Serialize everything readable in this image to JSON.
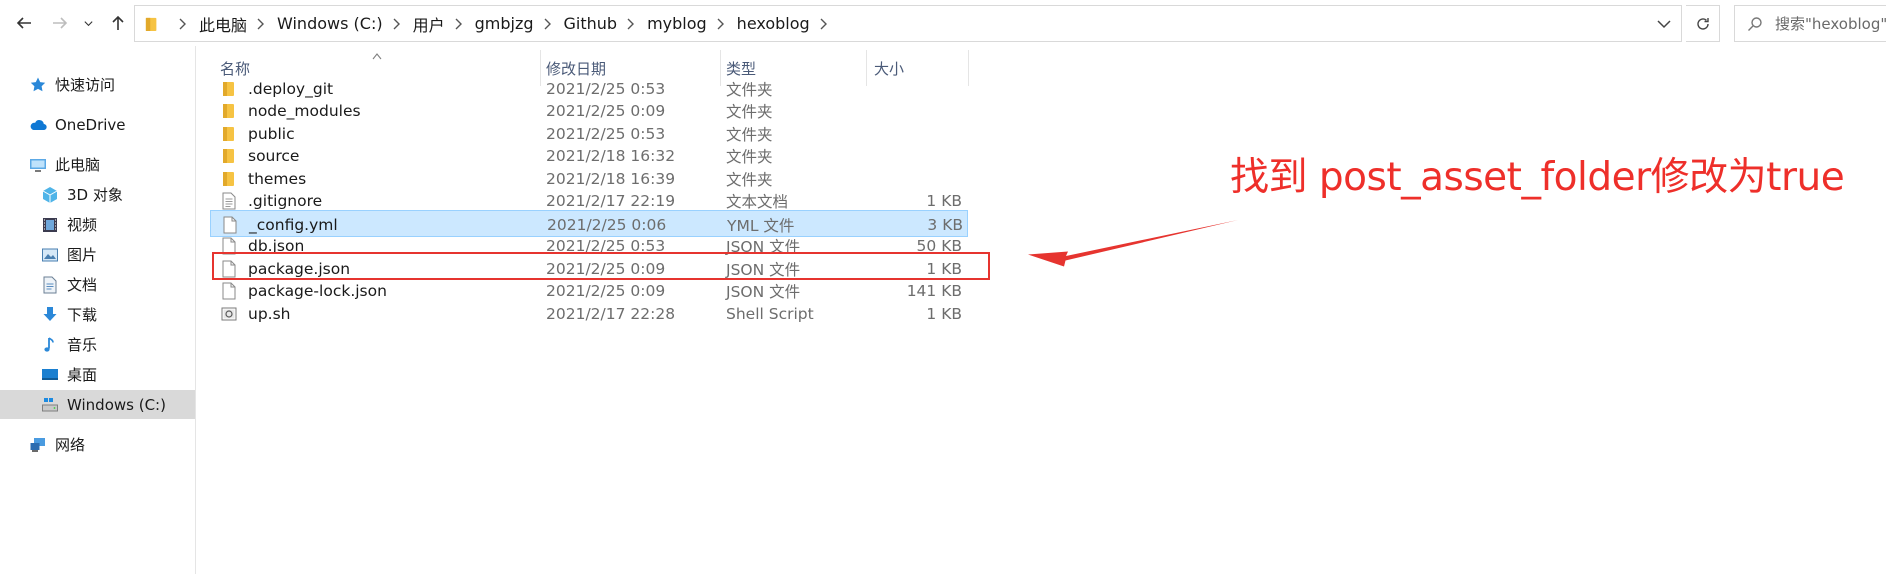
{
  "address_bar": {
    "crumbs": [
      "此电脑",
      "Windows (C:)",
      "用户",
      "gmbjzg",
      "Github",
      "myblog",
      "hexoblog"
    ]
  },
  "search": {
    "placeholder": "搜索\"hexoblog\""
  },
  "sidebar": {
    "items": [
      {
        "label": "快速访问",
        "icon": "star-icon"
      },
      {
        "label": "OneDrive",
        "icon": "cloud-icon"
      },
      {
        "label": "此电脑",
        "icon": "computer-icon"
      },
      {
        "label": "3D 对象",
        "icon": "cube-icon"
      },
      {
        "label": "视频",
        "icon": "video-icon"
      },
      {
        "label": "图片",
        "icon": "picture-icon"
      },
      {
        "label": "文档",
        "icon": "document-icon"
      },
      {
        "label": "下载",
        "icon": "download-icon"
      },
      {
        "label": "音乐",
        "icon": "music-icon"
      },
      {
        "label": "桌面",
        "icon": "desktop-icon"
      },
      {
        "label": "Windows (C:)",
        "icon": "drive-icon"
      },
      {
        "label": "网络",
        "icon": "network-icon"
      }
    ]
  },
  "columns": {
    "name": "名称",
    "modified": "修改日期",
    "type": "类型",
    "size": "大小"
  },
  "files": [
    {
      "name": ".deploy_git",
      "date": "2021/2/25 0:53",
      "type": "文件夹",
      "size": "",
      "kind": "folder"
    },
    {
      "name": "node_modules",
      "date": "2021/2/25 0:09",
      "type": "文件夹",
      "size": "",
      "kind": "folder"
    },
    {
      "name": "public",
      "date": "2021/2/25 0:53",
      "type": "文件夹",
      "size": "",
      "kind": "folder"
    },
    {
      "name": "source",
      "date": "2021/2/18 16:32",
      "type": "文件夹",
      "size": "",
      "kind": "folder"
    },
    {
      "name": "themes",
      "date": "2021/2/18 16:39",
      "type": "文件夹",
      "size": "",
      "kind": "folder"
    },
    {
      "name": ".gitignore",
      "date": "2021/2/17 22:19",
      "type": "文本文档",
      "size": "1 KB",
      "kind": "text"
    },
    {
      "name": "_config.yml",
      "date": "2021/2/25 0:06",
      "type": "YML 文件",
      "size": "3 KB",
      "kind": "file"
    },
    {
      "name": "db.json",
      "date": "2021/2/25 0:53",
      "type": "JSON 文件",
      "size": "50 KB",
      "kind": "file"
    },
    {
      "name": "package.json",
      "date": "2021/2/25 0:09",
      "type": "JSON 文件",
      "size": "1 KB",
      "kind": "file"
    },
    {
      "name": "package-lock.json",
      "date": "2021/2/25 0:09",
      "type": "JSON 文件",
      "size": "141 KB",
      "kind": "file"
    },
    {
      "name": "up.sh",
      "date": "2021/2/17 22:28",
      "type": "Shell Script",
      "size": "1 KB",
      "kind": "script"
    }
  ],
  "annotation": {
    "text": "找到 post_asset_folder修改为true",
    "color": "#ee2f2a"
  },
  "colors": {
    "selection": "#cce8ff",
    "folder": "#f6c343",
    "annotation_red": "#e6342f"
  }
}
